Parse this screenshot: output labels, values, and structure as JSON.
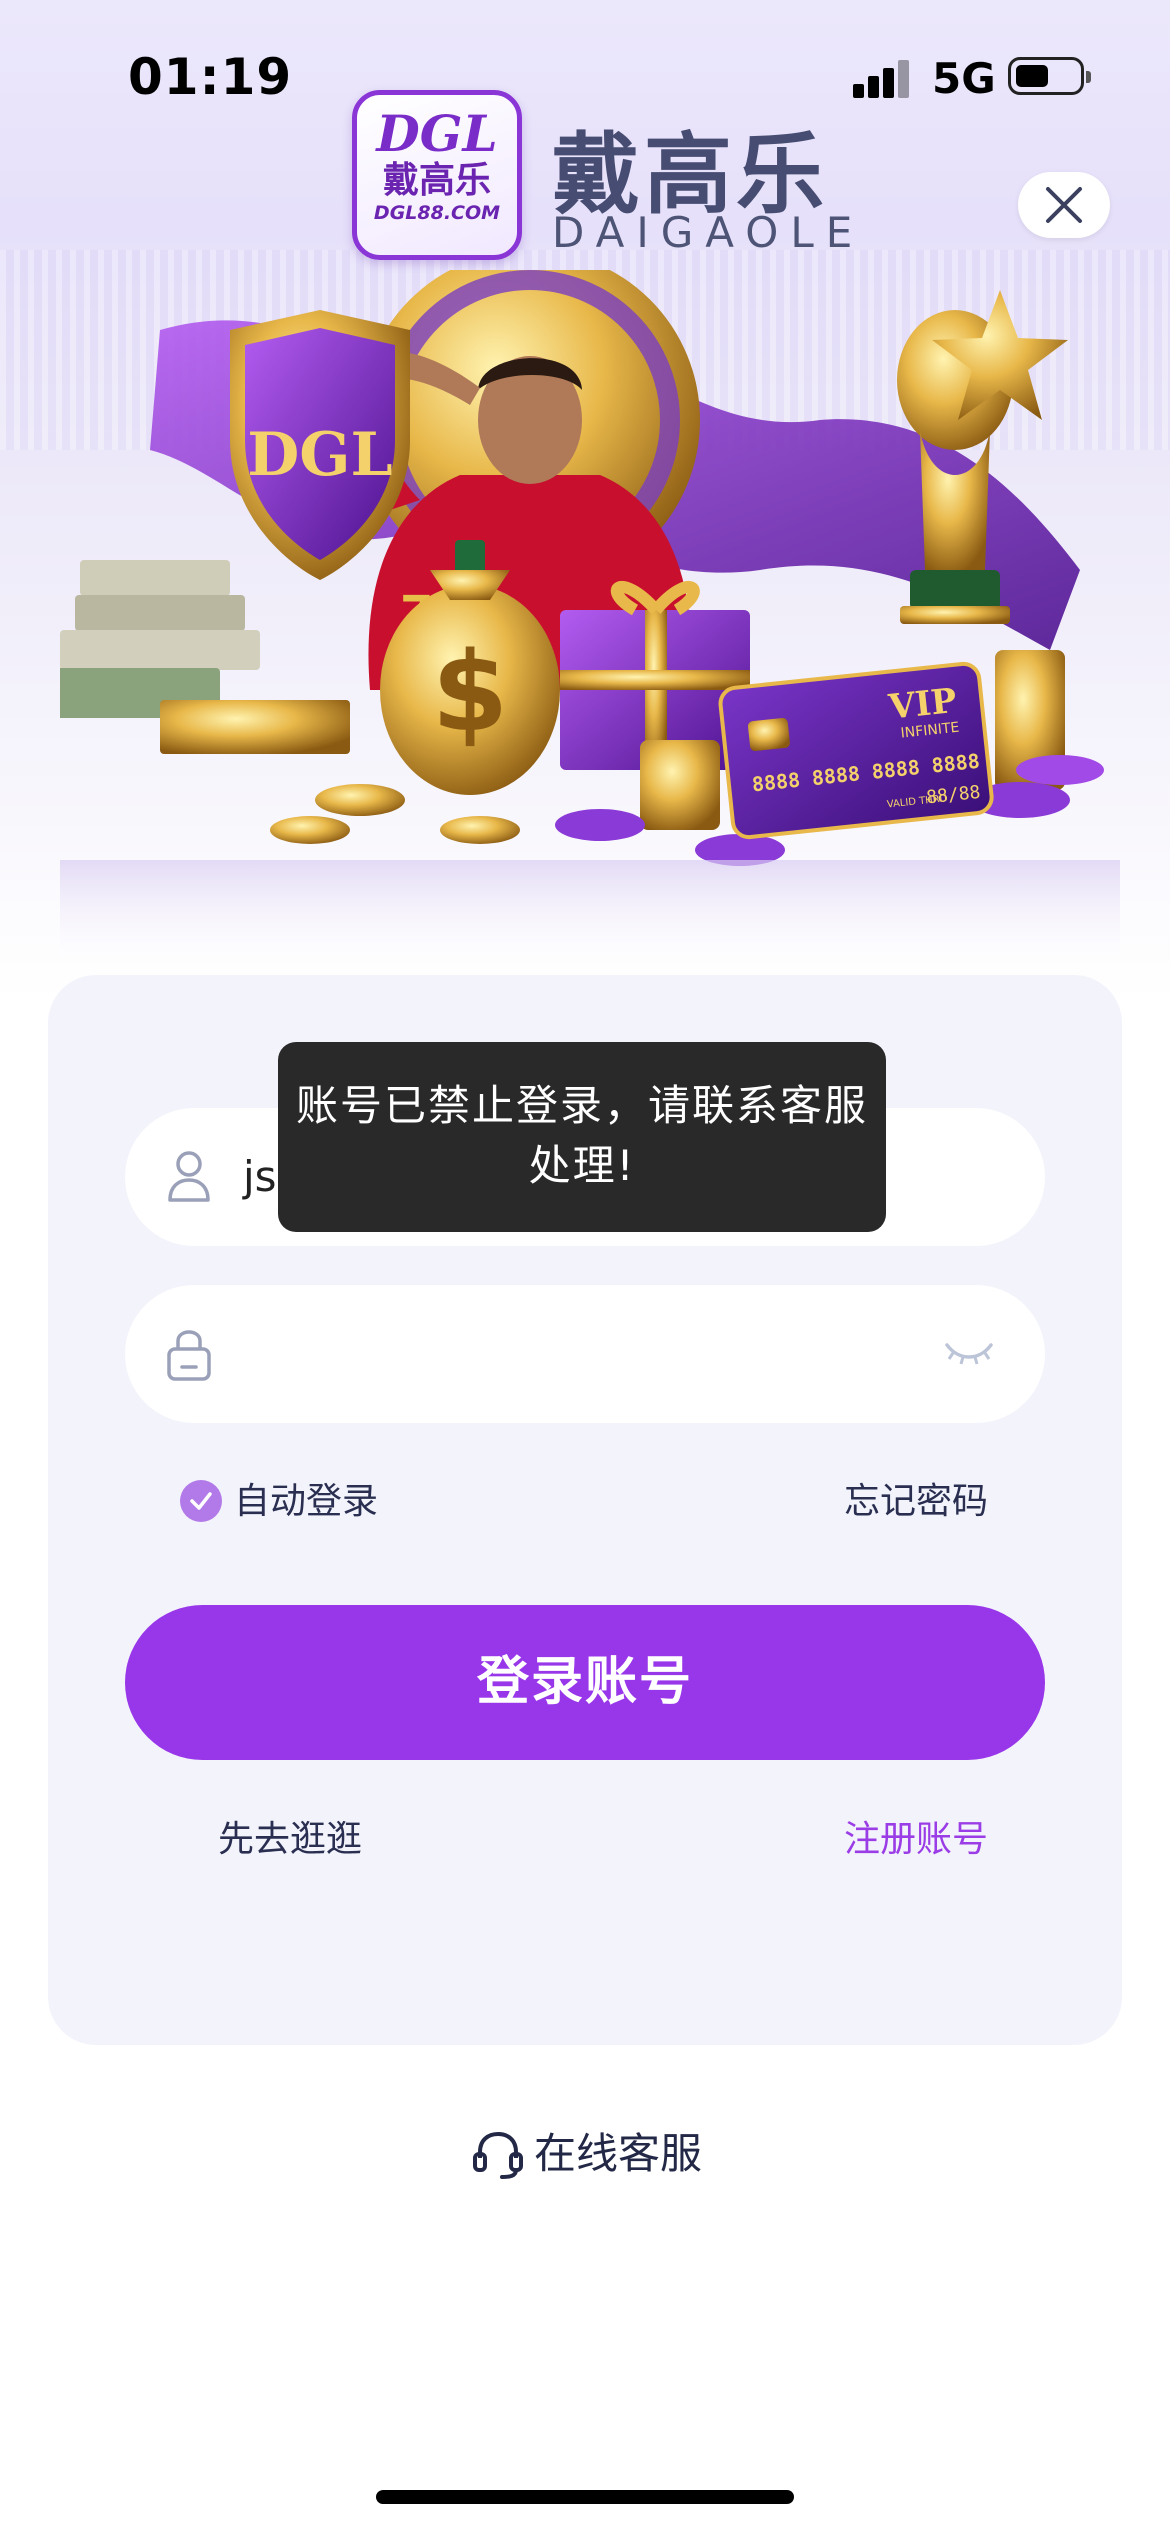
{
  "status_bar": {
    "time": "01:19",
    "network": "5G"
  },
  "brand": {
    "badge_line1": "DGL",
    "badge_line2": "戴高乐",
    "badge_line3": "DGL88.COM",
    "name_cn": "戴高乐",
    "name_en": "DAIGAOLE"
  },
  "hero": {
    "shield_text": "DGL",
    "card_title": "VIP",
    "card_subtitle": "INFINITE",
    "card_number": "8888 8888 8888 8888",
    "card_valid_label": "VALID THRU",
    "card_expiry": "88/88",
    "jersey_number": "7"
  },
  "login_form": {
    "username_value": "js",
    "password_value": "",
    "auto_login_label": "自动登录",
    "auto_login_checked": true,
    "forgot_password": "忘记密码",
    "login_button": "登录账号",
    "browse_link": "先去逛逛",
    "register_link": "注册账号"
  },
  "support": {
    "label": "在线客服"
  },
  "toast": {
    "message": "账号已禁止登录，请联系客服处理!"
  },
  "colors": {
    "accent": "#9836ea",
    "register_link": "#9b3de6",
    "text_dark": "#2a2f52",
    "card_bg": "#f3f4fb",
    "toast_bg": "#1e1e1e"
  },
  "icons": {
    "close": "close-icon",
    "username": "user-icon",
    "password": "lock-icon",
    "eye": "eye-closed-icon",
    "check": "check-icon",
    "support": "headset-icon"
  }
}
